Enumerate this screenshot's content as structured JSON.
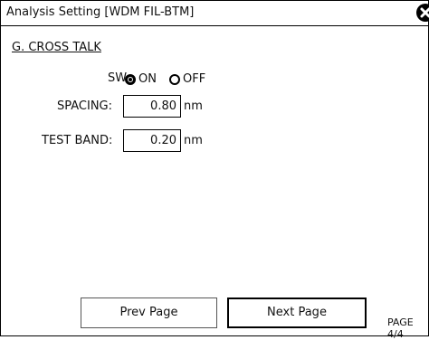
{
  "window": {
    "title": "Analysis Setting [WDM FIL-BTM]",
    "close_icon": "close-icon"
  },
  "section": {
    "title": "G. CROSS TALK"
  },
  "switch": {
    "label": "SW:",
    "options": [
      {
        "label": "ON",
        "selected": true
      },
      {
        "label": "OFF",
        "selected": false
      }
    ]
  },
  "spacing": {
    "label": "SPACING:",
    "value": "0.80",
    "unit": "nm"
  },
  "test_band": {
    "label": "TEST BAND:",
    "value": "0.20",
    "unit": "nm"
  },
  "buttons": {
    "prev_label": "Prev Page",
    "next_label": "Next Page"
  },
  "page_info": "PAGE 4/4"
}
